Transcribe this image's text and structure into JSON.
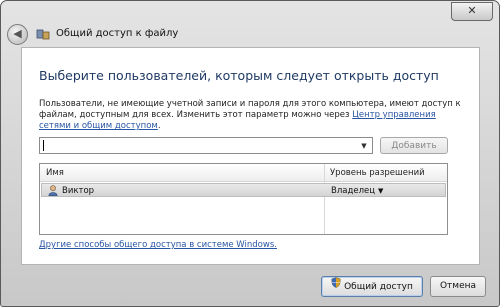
{
  "window": {
    "title": "Общий доступ к файлу",
    "close_label": "✕"
  },
  "heading": "Выберите пользователей, которым следует открыть доступ",
  "description": {
    "text": "Пользователи, не имеющие учетной записи и пароля для этого компьютера, имеют доступ к файлам, доступным для всех.  Изменить этот параметр можно через ",
    "link_text": "Центр управления сетями и общим доступом",
    "suffix": "."
  },
  "user_input": {
    "value": "",
    "placeholder": ""
  },
  "add_button": "Добавить",
  "table": {
    "columns": [
      "Имя",
      "Уровень разрешений"
    ],
    "rows": [
      {
        "name": "Виктор",
        "permission": "Владелец"
      }
    ]
  },
  "other_link": "Другие способы общего доступа в системе Windows.",
  "footer": {
    "share_label": "Общий доступ",
    "cancel_label": "Отмена"
  },
  "icons": {
    "back": "back-arrow-icon",
    "title": "file-share-icon",
    "user": "user-icon",
    "shield": "shield-icon",
    "dropdown": "chevron-down-icon"
  }
}
